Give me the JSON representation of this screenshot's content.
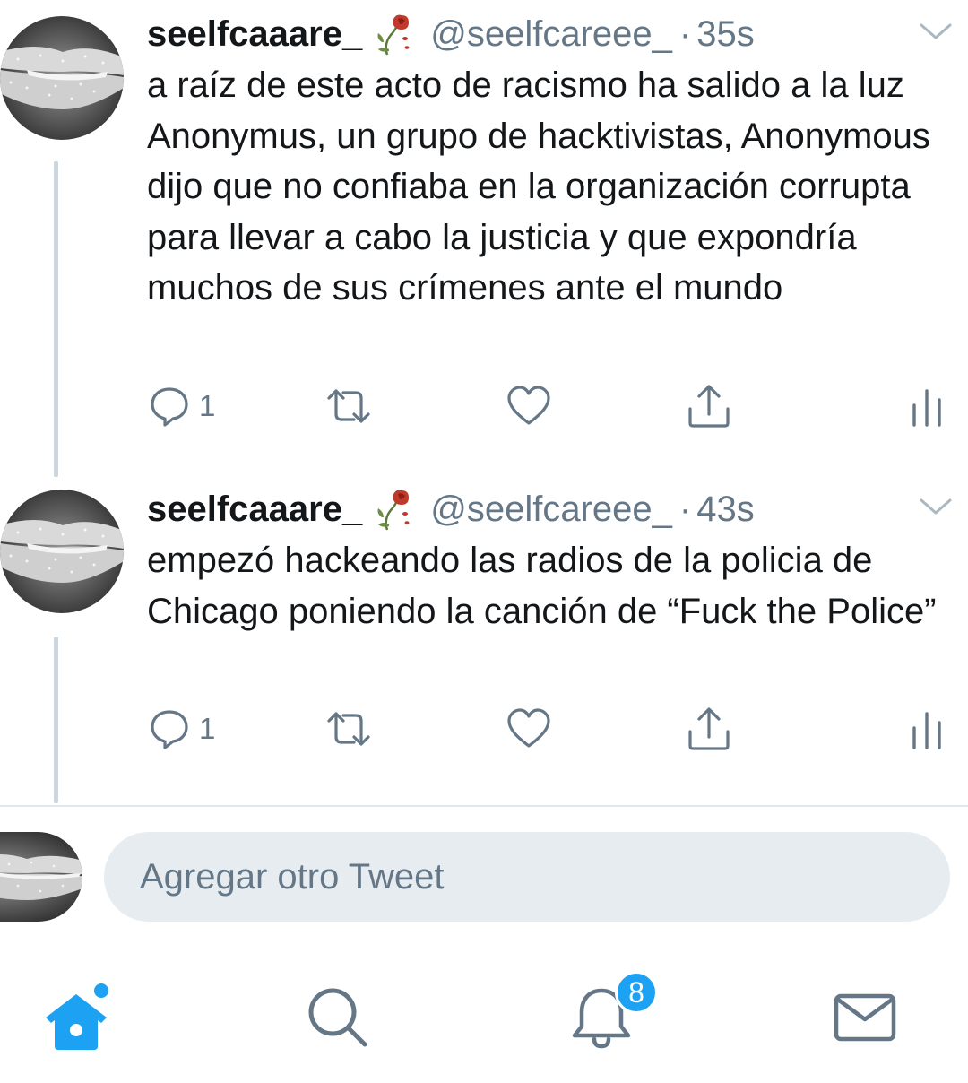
{
  "tweets": [
    {
      "display_name": "seelfcaaare_",
      "name_emoji_icon": "wilted-rose-icon",
      "handle": "@seelfcareee_",
      "separator": "·",
      "time": "35s",
      "text": "a raíz de este acto de racismo ha salido a la luz Anonymus, un grupo de hacktivistas, Anonymous dijo que no confiaba en la organización corrupta para llevar a cabo la justicia y que expondría muchos de sus crímenes ante el mundo",
      "reply_count": "1"
    },
    {
      "display_name": "seelfcaaare_",
      "name_emoji_icon": "wilted-rose-icon",
      "handle": "@seelfcareee_",
      "separator": "·",
      "time": "43s",
      "text": "empezó hackeando las radios de la policia de Chicago poniendo la canción de “Fuck the Police”",
      "reply_count": "1"
    }
  ],
  "compose": {
    "placeholder": "Agregar otro Tweet"
  },
  "tabbar": {
    "items": [
      "home-icon",
      "search-icon",
      "notifications-icon",
      "messages-icon"
    ],
    "notifications_badge": "8"
  },
  "colors": {
    "accent": "#1da1f2",
    "text": "#14171a",
    "secondary_text": "#657786",
    "thread_line": "#ccd6dd",
    "input_background": "#e6ecf0"
  }
}
